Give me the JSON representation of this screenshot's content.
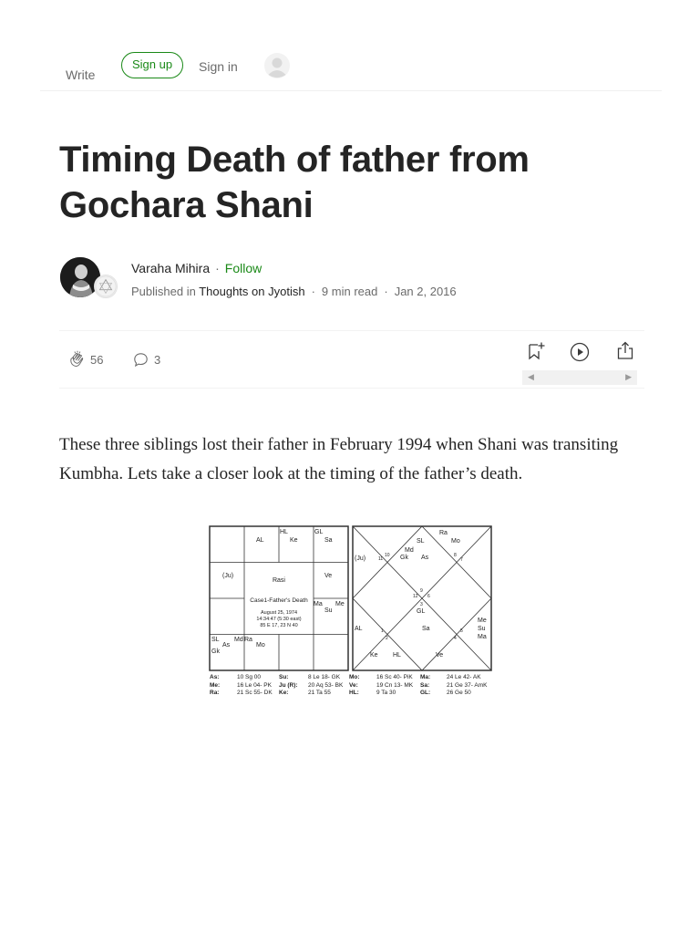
{
  "nav": {
    "write": "Write",
    "sign_up": "Sign up",
    "sign_in": "Sign in"
  },
  "article": {
    "title": "Timing Death of father from Gochara Shani",
    "author": "Varaha Mihira",
    "follow": "Follow",
    "published_in_prefix": "Published in",
    "publication": "Thoughts on Jyotish",
    "read_time": "9 min read",
    "date": "Jan 2, 2016",
    "claps": "56",
    "responses": "3",
    "body": "These three siblings lost their father in February 1994 when Shani was transiting Kumbha. Lets take a closer look at the timing of the father’s death."
  },
  "chart_figure": {
    "rasi": {
      "cells": {
        "top2": "AL",
        "top3a": "HL",
        "top3b": "Ke",
        "top4a": "GL",
        "top4b": "Sa",
        "left2": "(Ju)",
        "right2": "Ve",
        "right3a": "Ma",
        "right3b": "Me",
        "right3c": "Su",
        "bottom1a": "SL",
        "bottom1b": "Md",
        "bottom1c": "As",
        "bottom1d": "Gk",
        "bottom2a": "Ra",
        "bottom2b": "Mo"
      },
      "center_label": "Rasi",
      "case_title": "Case1-Father's Death",
      "birth_date": "August 25, 1974",
      "birth_time": "14:34:47 (5:30 east)",
      "birth_place": "85 E 17, 23 N 40"
    },
    "north": {
      "labels": [
        "Ra",
        "SL",
        "Mo",
        "Md",
        "(Ju)",
        "Gk",
        "As",
        "GL",
        "Sa",
        "AL",
        "Me",
        "Su",
        "Ma",
        "Ke",
        "HL",
        "Ve"
      ],
      "numbers": [
        "11",
        "10",
        "8",
        "7",
        "9",
        "12",
        "6",
        "3",
        "1",
        "2",
        "4",
        "5"
      ]
    },
    "table": [
      [
        {
          "k": "As:",
          "v": "10 Sg 00"
        },
        {
          "k": "Su:",
          "v": "8 Le 18- GK"
        },
        {
          "k": "Mo:",
          "v": "16 Sc 40- PiK"
        },
        {
          "k": "Ma:",
          "v": "24 Le 42- AK"
        }
      ],
      [
        {
          "k": "Me:",
          "v": "16 Le 04- PK"
        },
        {
          "k": "Ju (R):",
          "v": "20 Aq 53- BK"
        },
        {
          "k": "Ve:",
          "v": "19 Cn 13- MK"
        },
        {
          "k": "Sa:",
          "v": "21 Ge 37- AmK"
        }
      ],
      [
        {
          "k": "Ra:",
          "v": "21 Sc 55- DK"
        },
        {
          "k": "Ke:",
          "v": "21 Ta 55"
        },
        {
          "k": "HL:",
          "v": "9 Ta 30"
        },
        {
          "k": "GL:",
          "v": "26 Ge 50"
        }
      ]
    ]
  },
  "colors": {
    "accent": "#1a8917",
    "text": "#242424",
    "muted": "#6b6b6b"
  },
  "icons": [
    "clap-icon",
    "response-icon",
    "bookmark-add-icon",
    "play-icon",
    "share-icon",
    "user-icon"
  ]
}
